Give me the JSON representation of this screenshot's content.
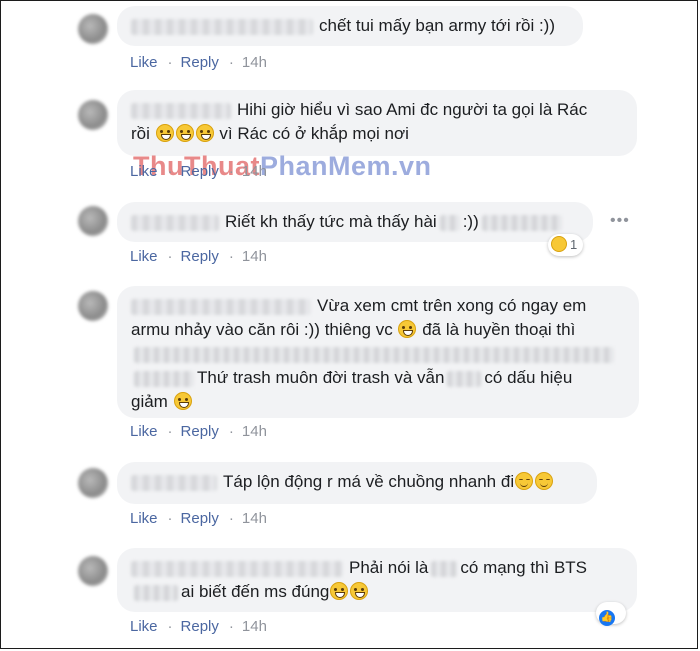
{
  "actions": {
    "like": "Like",
    "reply": "Reply",
    "separator": "·",
    "time": "14h"
  },
  "watermark": {
    "part1": "ThuThuat",
    "part2": "PhanMem.vn"
  },
  "comments": [
    {
      "line1": "chết tui mấy bạn army tới rồi :))"
    },
    {
      "line1": "Hihi giờ hiểu vì sao Ami đc người ta gọi là Rác",
      "line2a": "rồi",
      "line2b": "vì Rác có ở khắp mọi nơi"
    },
    {
      "line1": "Riết kh thấy tức mà thấy hài",
      "line1b": ":))",
      "reaction_count": "1"
    },
    {
      "line1": "Vừa xem cmt trên xong có ngay em",
      "line2a": "armu nhảy vào căn rôi :)) thiêng vc",
      "line2b": "đã là huyền thoại thì",
      "line4": "Thứ trash muôn đời trash và vẫn",
      "line4b": "có dấu hiệu",
      "line5": "giảm"
    },
    {
      "line1": "Táp lộn động r má về chuồng nhanh đi"
    },
    {
      "line1a": "Phải nói là",
      "line1b": "có mạng thì BTS",
      "line2": "ai biết đến ms đúng"
    }
  ],
  "colors": {
    "bubble": "#f2f3f5",
    "link": "#4b67a1",
    "muted": "#90949c"
  }
}
